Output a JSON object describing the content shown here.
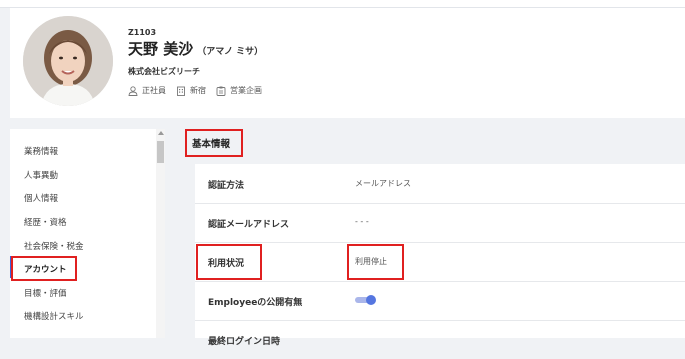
{
  "profile": {
    "employee_id": "Z1103",
    "name": "天野 美沙",
    "kana": "（アマノ ミサ）",
    "company": "株式会社ビズリーチ",
    "meta": [
      {
        "icon": "person-icon",
        "label": "正社員"
      },
      {
        "icon": "building-icon",
        "label": "新宿"
      },
      {
        "icon": "badge-icon",
        "label": "営業企画"
      }
    ]
  },
  "sidebar": {
    "items": [
      {
        "label": "業務情報"
      },
      {
        "label": "人事異動"
      },
      {
        "label": "個人情報"
      },
      {
        "label": "経歴・資格"
      },
      {
        "label": "社会保険・税金"
      },
      {
        "label": "アカウント",
        "active": true
      },
      {
        "label": "目標・評価"
      },
      {
        "label": "機構設計スキル"
      }
    ]
  },
  "section": {
    "title": "基本情報"
  },
  "basic_info": {
    "rows": [
      {
        "label": "認証方法",
        "value": "メールアドレス"
      },
      {
        "label": "認証メールアドレス",
        "value": "- - -"
      },
      {
        "label": "利用状況",
        "value": "利用停止"
      },
      {
        "label": "Employeeの公開有無",
        "toggle_on": true
      },
      {
        "label": "最終ログイン日時"
      }
    ]
  },
  "colors": {
    "accent": "#3a63d8",
    "highlight": "#e02020"
  }
}
